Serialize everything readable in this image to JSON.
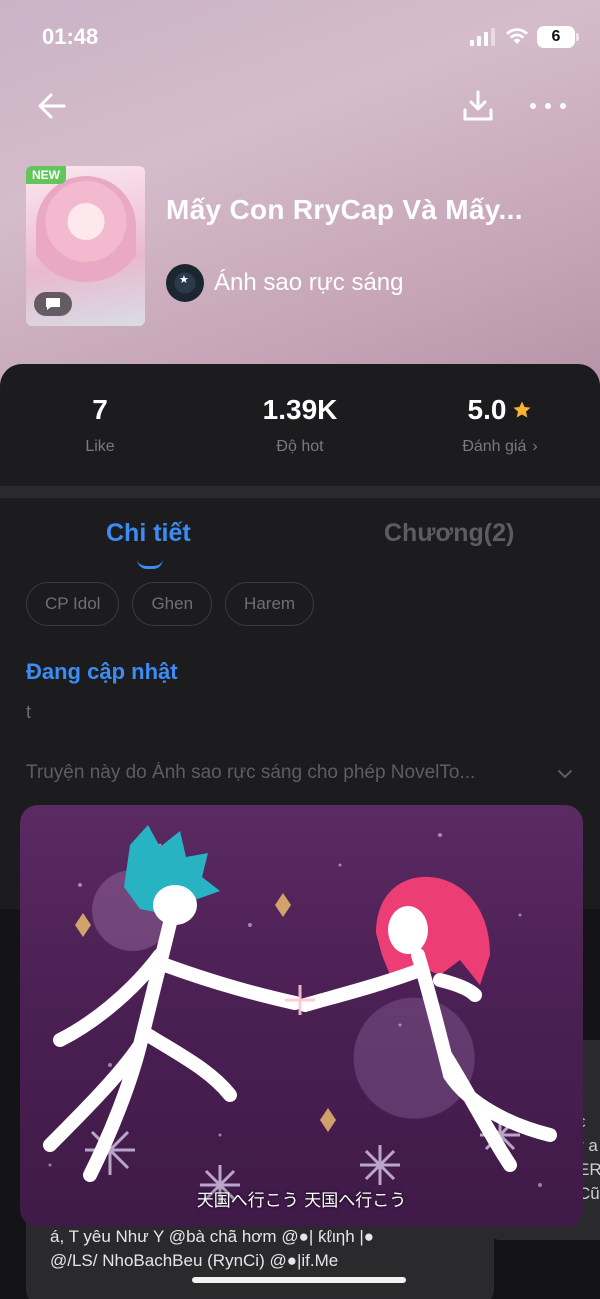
{
  "status_bar": {
    "time": "01:48",
    "battery": "6"
  },
  "book": {
    "badge": "NEW",
    "title": "Mấy Con RryCap Và Mấy...",
    "author": "Ánh sao rực sáng"
  },
  "stats": [
    {
      "value": "7",
      "label": "Like"
    },
    {
      "value": "1.39K",
      "label": "Độ hot"
    },
    {
      "value": "5.0",
      "label": "Đánh giá",
      "chevron": "›"
    }
  ],
  "tabs": [
    {
      "label": "Chi tiết",
      "active": true
    },
    {
      "label": "Chương(2)",
      "active": false
    }
  ],
  "tags": [
    "CP Idol",
    "Ghen",
    "Harem"
  ],
  "status_text": "Đang cập nhật",
  "description": "t",
  "license": "Truyện này do Ánh sao rực sáng cho phép NovelTo...",
  "video": {
    "subtitle": "天国へ行こう 天国へ行こう"
  },
  "comment_preview": [
    "á, T yêu Như Y @bà chã hơm @●| ƙℓιηh |●",
    "@/LS/ NhoBachBeu (RynCi) @●|if.Me"
  ],
  "side_preview": [
    "ε",
    "r a",
    "ER",
    "Cũ"
  ],
  "colors": {
    "accent": "#3b8df5",
    "background": "#1c1c1e",
    "star": "#f6b431",
    "new_badge": "#62c65c"
  }
}
